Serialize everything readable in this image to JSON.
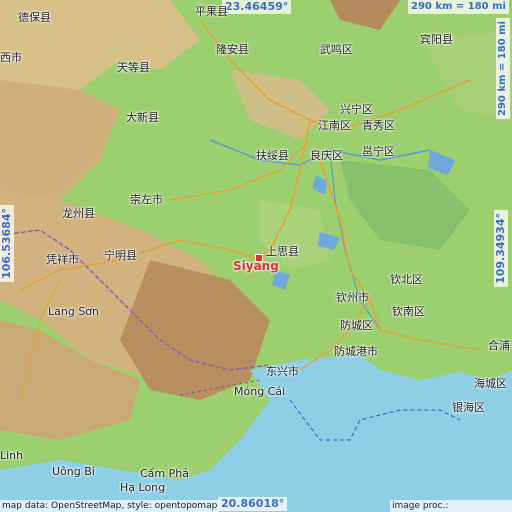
{
  "coords": {
    "top": "23.46459°",
    "bottom": "20.86018°",
    "left": "106.53684°",
    "right": "109.34934°"
  },
  "scale": {
    "top": "290 km = 180 mi",
    "right": "290 km = 180 mi"
  },
  "target": "Siyang",
  "cities": [
    {
      "name": "德保县"
    },
    {
      "name": "平果县"
    },
    {
      "name": "西市"
    },
    {
      "name": "天等县"
    },
    {
      "name": "隆安县"
    },
    {
      "name": "武鸣区"
    },
    {
      "name": "宾阳县"
    },
    {
      "name": "大新县"
    },
    {
      "name": "兴宁区"
    },
    {
      "name": "江南区"
    },
    {
      "name": "青秀区"
    },
    {
      "name": "扶绥县"
    },
    {
      "name": "良庆区"
    },
    {
      "name": "邕宁区"
    },
    {
      "name": "崇左市"
    },
    {
      "name": "龙州县"
    },
    {
      "name": "宁明县"
    },
    {
      "name": "凭祥市"
    },
    {
      "name": "上思县"
    },
    {
      "name": "钦北区"
    },
    {
      "name": "Lang Sơn"
    },
    {
      "name": "钦州市"
    },
    {
      "name": "钦南区"
    },
    {
      "name": "防城区"
    },
    {
      "name": "合浦"
    },
    {
      "name": "防城港市"
    },
    {
      "name": "海城区"
    },
    {
      "name": "东兴市"
    },
    {
      "name": "Móng Cái"
    },
    {
      "name": "银海区"
    },
    {
      "name": "Linh"
    },
    {
      "name": "Uông Bí"
    },
    {
      "name": "Cẩm Phả"
    },
    {
      "name": "Hạ Long"
    }
  ],
  "credits": {
    "left": "map data: OpenStreetMap, style: opentopomap",
    "right": "image proc.: elevation.city"
  },
  "colors": {
    "sea": "#8ecfe6",
    "lowland": "#9ccf6e",
    "hill": "#d9c88a",
    "mountain": "#c49a6a",
    "label_accent": "#3a6cc8",
    "target": "#e03030"
  }
}
